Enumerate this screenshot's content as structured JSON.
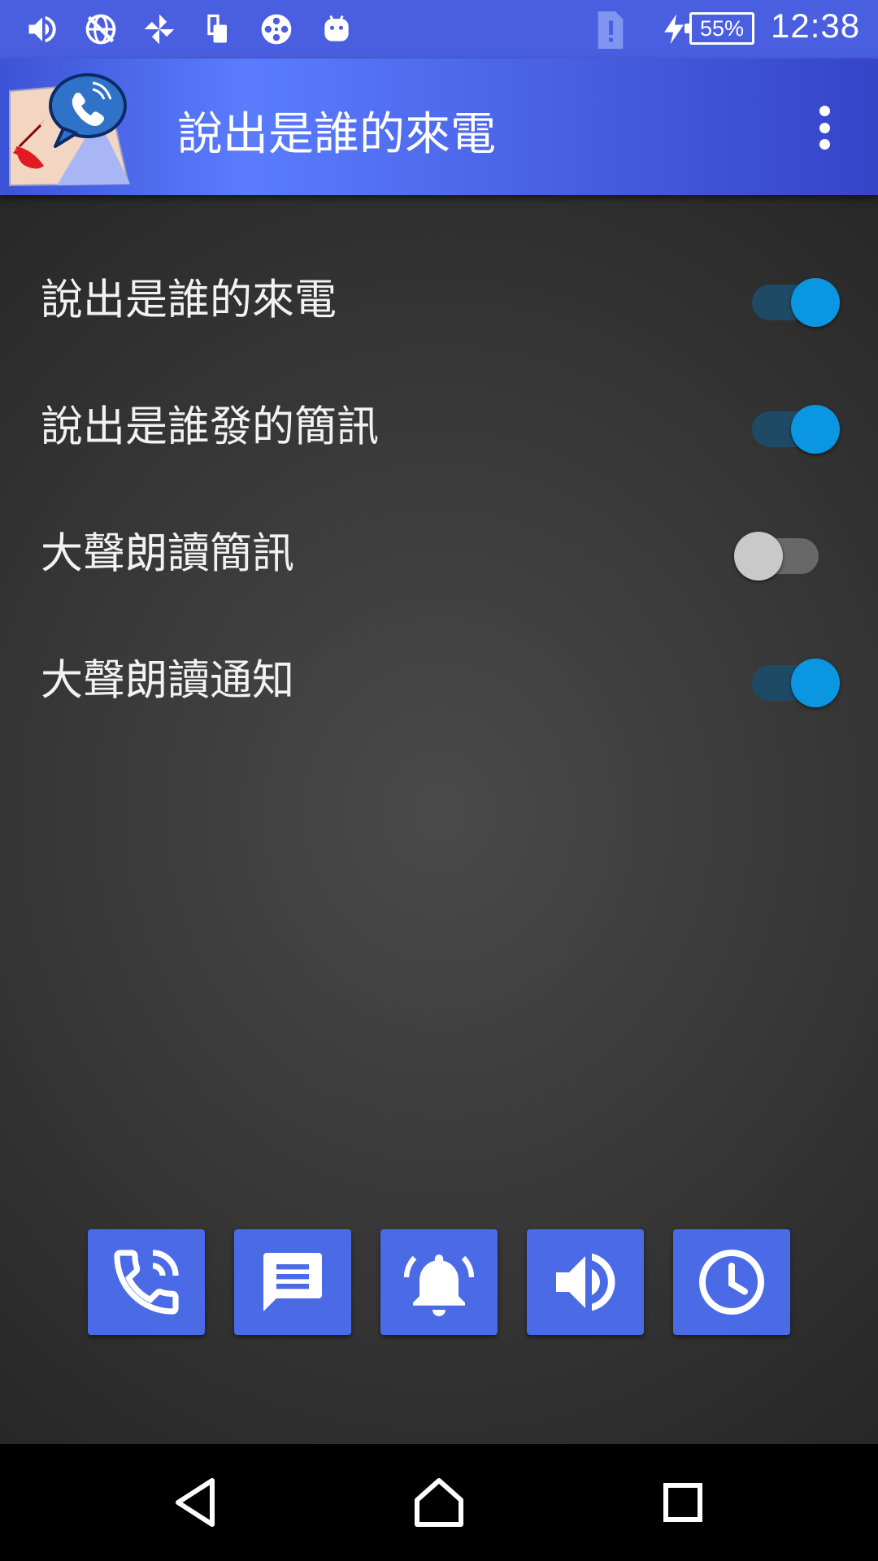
{
  "status_bar": {
    "icons": [
      "volume-icon",
      "no-network-icon",
      "pinwheel-icon",
      "phone-screen-icon",
      "film-reel-icon",
      "android-icon",
      "sim-alert-icon",
      "charging-icon"
    ],
    "battery": "55%",
    "time": "12:38"
  },
  "app_bar": {
    "title": "說出是誰的來電",
    "logo": "talking-caller-logo",
    "menu_icon": "overflow-menu-icon"
  },
  "settings": [
    {
      "label": "說出是誰的來電",
      "enabled": true
    },
    {
      "label": "說出是誰發的簡訊",
      "enabled": true
    },
    {
      "label": "大聲朗讀簡訊",
      "enabled": false
    },
    {
      "label": "大聲朗讀通知",
      "enabled": true
    }
  ],
  "actions": [
    "incoming-call-icon",
    "message-icon",
    "alarm-bell-icon",
    "speaker-icon",
    "clock-icon"
  ],
  "nav": [
    "back-icon",
    "home-icon",
    "recents-icon"
  ],
  "colors": {
    "accent": "#0a96e0",
    "primary": "#4a6ae6",
    "switch_track_on": "#1f4a66"
  }
}
